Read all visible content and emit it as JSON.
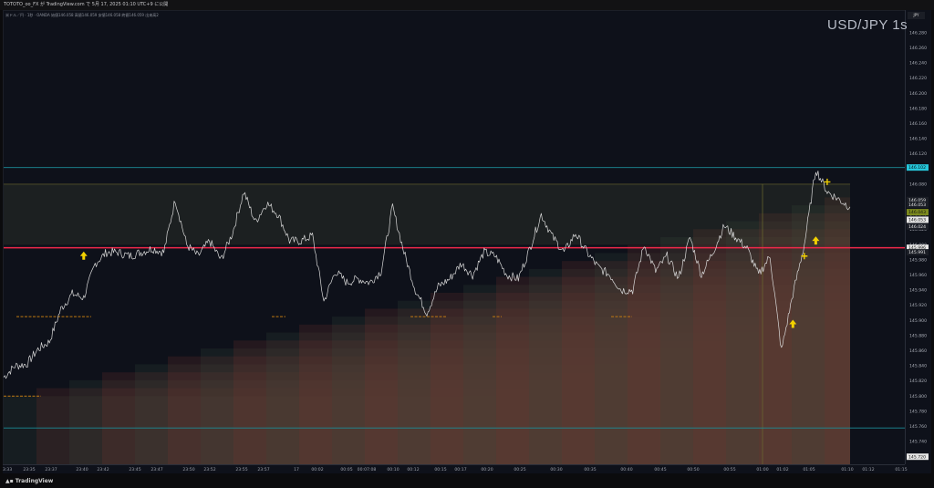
{
  "header": {
    "published_by": "TOTOTO_oo_FX が TradingView.com で 5月 17, 2025 01:10 UTC+9 に公開"
  },
  "legend": {
    "text": "米ドル／円 · 1秒 · OANDA 始値146.058 高値146.059 安値146.058 終値146.059 出来高2"
  },
  "symbol_title": "USD/JPY 1s",
  "currency_tag": "JPY",
  "footer": {
    "brand": "TradingView"
  },
  "colors": {
    "background": "#0e111a",
    "price_line": "#d9d9d9",
    "red_line": "#f2294a",
    "teal_line": "#1b8c97",
    "olive": "#7a7a34",
    "marker_yellow": "#f2d100",
    "tag_teal": "#26c6da",
    "tag_olive": "#7c8a1e"
  },
  "chart_data": {
    "type": "line",
    "title": "USD/JPY 1s",
    "ylim": [
      145.71,
      146.31
    ],
    "y_ticks": [
      146.28,
      146.26,
      146.24,
      146.22,
      146.2,
      146.18,
      146.16,
      146.14,
      146.12,
      146.1,
      146.08,
      146.06,
      146.04,
      146.02,
      146.0,
      145.98,
      145.96,
      145.94,
      145.92,
      145.9,
      145.88,
      145.86,
      145.84,
      145.82,
      145.8,
      145.78,
      145.76,
      145.74,
      145.72
    ],
    "y_tick_labels": [
      "146.280",
      "146.260",
      "146.240",
      "146.220",
      "146.200",
      "146.180",
      "146.160",
      "146.140",
      "146.120",
      "146.100",
      "146.080",
      "146.060",
      "146.040",
      "146.020",
      "146.000",
      "145.980",
      "145.960",
      "145.940",
      "145.920",
      "145.900",
      "145.880",
      "145.860",
      "145.840",
      "145.820",
      "145.800",
      "145.780",
      "145.760",
      "145.740",
      "145.720"
    ],
    "x_labels": [
      "3:33",
      "23:35",
      "23:37",
      "23:40",
      "23:42",
      "23:45",
      "23:47",
      "23:50",
      "23:52",
      "23:55",
      "23:57",
      "17",
      "00:02",
      "00:05",
      "00:07:08",
      "00:10",
      "00:12",
      "00:15",
      "00:17",
      "00:20",
      "00:25",
      "00:30",
      "00:35",
      "00:40",
      "00:45",
      "00:50",
      "00:55",
      "01:00",
      "01:02",
      "01:05",
      "01:10",
      "01:12",
      "01:15"
    ],
    "series": [
      {
        "values": [
          145.825,
          145.84,
          145.842,
          145.862,
          145.872,
          145.915,
          145.935,
          145.93,
          145.975,
          145.99,
          145.99,
          145.985,
          145.99,
          145.995,
          145.99,
          146.06,
          146.0,
          145.985,
          146.005,
          145.98,
          146.015,
          146.07,
          146.03,
          146.055,
          146.04,
          146.005,
          146.005,
          146.012,
          145.925,
          145.965,
          145.95,
          145.955,
          145.95,
          145.965,
          146.05,
          145.99,
          145.94,
          145.91,
          145.945,
          145.955,
          145.975,
          145.96,
          145.99,
          145.985,
          145.96,
          145.955,
          145.995,
          146.04,
          146.01,
          145.99,
          146.015,
          145.99,
          145.97,
          145.96,
          145.94,
          145.94,
          146.0,
          145.965,
          145.985,
          145.955,
          146.01,
          145.96,
          145.99,
          146.025,
          146.01,
          145.995,
          145.96,
          145.985,
          145.86,
          145.935,
          146.0,
          146.1,
          146.07,
          146.06,
          146.05
        ]
      }
    ],
    "horizontal_lines": [
      {
        "value": 146.102,
        "label": "146.102",
        "color": "#1b8c97"
      },
      {
        "value": 145.996,
        "label": "145.996",
        "color": "#f2294a"
      },
      {
        "value": 145.758,
        "label": "",
        "color": "#1b8c97"
      }
    ],
    "price_tags": [
      {
        "value": 146.102,
        "label": "146.102",
        "style": "teal"
      },
      {
        "value": 146.059,
        "label": "146.059",
        "style": "dark"
      },
      {
        "value": 146.053,
        "label": "146.053",
        "style": "dark"
      },
      {
        "value": 146.043,
        "label": "146.043",
        "style": "olive"
      },
      {
        "value": 146.033,
        "label": "146.053",
        "style": "white"
      },
      {
        "value": 146.024,
        "label": "146.024",
        "style": "dark"
      },
      {
        "value": 145.996,
        "label": "145.996",
        "style": "white"
      },
      {
        "value": 145.99,
        "label": "145.991",
        "style": "dark"
      },
      {
        "value": 145.72,
        "label": "145.720",
        "style": "white"
      }
    ],
    "markers": [
      {
        "x_index": 7,
        "value": 145.985,
        "kind": "arrow-up"
      },
      {
        "x_index": 69,
        "value": 145.895,
        "kind": "arrow-up"
      },
      {
        "x_index": 70,
        "value": 145.985,
        "kind": "plus"
      },
      {
        "x_index": 71,
        "value": 146.005,
        "kind": "arrow-up"
      },
      {
        "x_index": 72,
        "value": 146.083,
        "kind": "plus"
      }
    ]
  }
}
